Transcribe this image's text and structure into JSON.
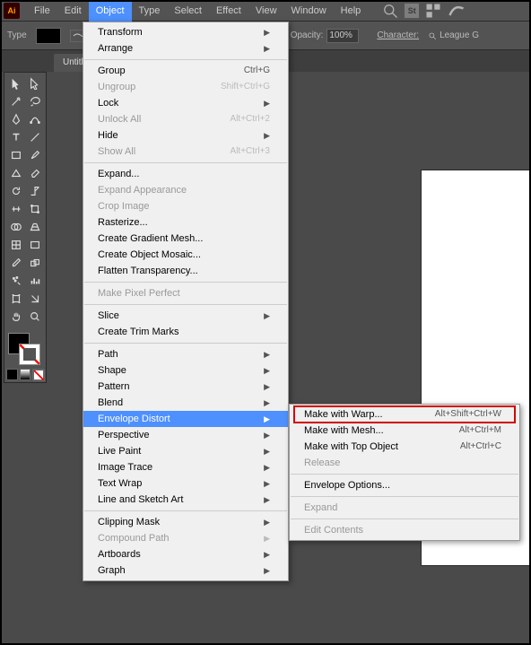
{
  "menubar": {
    "items": [
      "File",
      "Edit",
      "Object",
      "Type",
      "Select",
      "Effect",
      "View",
      "Window",
      "Help"
    ],
    "openIndex": 2
  },
  "optionsbar": {
    "typeLabel": "Type",
    "opacityLabel": "Opacity:",
    "opacityValue": "100%",
    "characterLabel": "Character:",
    "fontSearch": "League G"
  },
  "tab": {
    "label": "Untitl"
  },
  "objectMenu": [
    {
      "t": "Transform",
      "a": true
    },
    {
      "t": "Arrange",
      "a": true
    },
    {
      "sep": true
    },
    {
      "t": "Group",
      "sc": "Ctrl+G"
    },
    {
      "t": "Ungroup",
      "sc": "Shift+Ctrl+G",
      "dis": true
    },
    {
      "t": "Lock",
      "a": true
    },
    {
      "t": "Unlock All",
      "sc": "Alt+Ctrl+2",
      "dis": true
    },
    {
      "t": "Hide",
      "a": true
    },
    {
      "t": "Show All",
      "sc": "Alt+Ctrl+3",
      "dis": true
    },
    {
      "sep": true
    },
    {
      "t": "Expand..."
    },
    {
      "t": "Expand Appearance",
      "dis": true
    },
    {
      "t": "Crop Image",
      "dis": true
    },
    {
      "t": "Rasterize..."
    },
    {
      "t": "Create Gradient Mesh..."
    },
    {
      "t": "Create Object Mosaic..."
    },
    {
      "t": "Flatten Transparency..."
    },
    {
      "sep": true
    },
    {
      "t": "Make Pixel Perfect",
      "dis": true
    },
    {
      "sep": true
    },
    {
      "t": "Slice",
      "a": true
    },
    {
      "t": "Create Trim Marks"
    },
    {
      "sep": true
    },
    {
      "t": "Path",
      "a": true
    },
    {
      "t": "Shape",
      "a": true
    },
    {
      "t": "Pattern",
      "a": true
    },
    {
      "t": "Blend",
      "a": true
    },
    {
      "t": "Envelope Distort",
      "a": true,
      "hov": true
    },
    {
      "t": "Perspective",
      "a": true
    },
    {
      "t": "Live Paint",
      "a": true
    },
    {
      "t": "Image Trace",
      "a": true
    },
    {
      "t": "Text Wrap",
      "a": true
    },
    {
      "t": "Line and Sketch Art",
      "a": true
    },
    {
      "sep": true
    },
    {
      "t": "Clipping Mask",
      "a": true
    },
    {
      "t": "Compound Path",
      "a": true,
      "dis": true
    },
    {
      "t": "Artboards",
      "a": true
    },
    {
      "t": "Graph",
      "a": true
    }
  ],
  "envelopeMenu": [
    {
      "t": "Make with Warp...",
      "sc": "Alt+Shift+Ctrl+W",
      "boxed": true
    },
    {
      "t": "Make with Mesh...",
      "sc": "Alt+Ctrl+M"
    },
    {
      "t": "Make with Top Object",
      "sc": "Alt+Ctrl+C"
    },
    {
      "t": "Release",
      "dis": true
    },
    {
      "sep": true
    },
    {
      "t": "Envelope Options..."
    },
    {
      "sep": true
    },
    {
      "t": "Expand",
      "dis": true
    },
    {
      "sep": true
    },
    {
      "t": "Edit Contents",
      "dis": true
    }
  ],
  "tools": [
    [
      "selection",
      "direct-selection"
    ],
    [
      "magic-wand",
      "lasso"
    ],
    [
      "pen",
      "curvature"
    ],
    [
      "type",
      "line-segment"
    ],
    [
      "rectangle",
      "paintbrush"
    ],
    [
      "shaper",
      "eraser"
    ],
    [
      "rotate",
      "scale"
    ],
    [
      "width",
      "free-transform"
    ],
    [
      "shape-builder",
      "perspective-grid"
    ],
    [
      "mesh",
      "gradient"
    ],
    [
      "eyedropper",
      "blend"
    ],
    [
      "symbol-sprayer",
      "column-graph"
    ],
    [
      "artboard",
      "slice"
    ],
    [
      "hand",
      "zoom"
    ]
  ]
}
